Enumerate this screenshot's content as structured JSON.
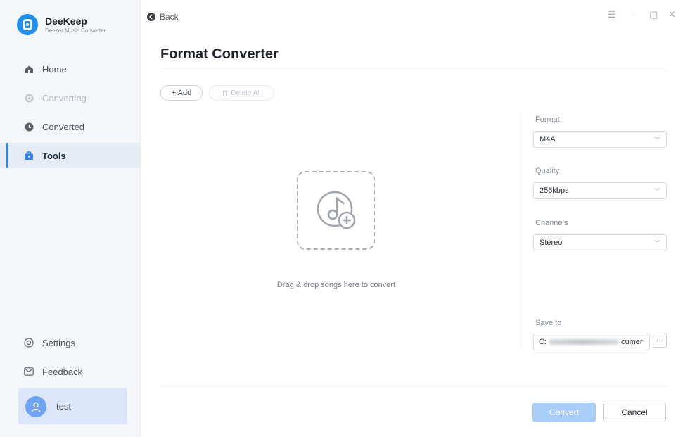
{
  "app": {
    "name": "DeeKeep",
    "subtitle": "Deezer Music Converter"
  },
  "sidebar": {
    "items": [
      {
        "label": "Home",
        "icon": "home-icon",
        "state": "normal"
      },
      {
        "label": "Converting",
        "icon": "converting-icon",
        "state": "disabled"
      },
      {
        "label": "Converted",
        "icon": "clock-icon",
        "state": "normal"
      },
      {
        "label": "Tools",
        "icon": "toolbox-icon",
        "state": "active"
      }
    ],
    "settings_label": "Settings",
    "feedback_label": "Feedback",
    "user_name": "test"
  },
  "topbar": {
    "back_label": "Back",
    "menu_glyph": "☰",
    "minimize_glyph": "–",
    "maximize_glyph": "▢",
    "close_glyph": "✕"
  },
  "main": {
    "title": "Format Converter",
    "add_label": "+ Add",
    "delete_all_label": "Delete All",
    "drop_text": "Drag & drop songs here to convert"
  },
  "settings": {
    "format": {
      "label": "Format",
      "value": "M4A"
    },
    "quality": {
      "label": "Quality",
      "value": "256kbps"
    },
    "channels": {
      "label": "Channels",
      "value": "Stereo"
    },
    "save_to": {
      "label": "Save to",
      "value_start": "C:",
      "value_end": "cumer",
      "browse_label": "···"
    }
  },
  "actions": {
    "convert_label": "Convert",
    "cancel_label": "Cancel"
  },
  "colors": {
    "accent": "#2f7ff5",
    "convert_disabled": "#a9cdf9",
    "sidebar_bg": "#f4f6f9"
  }
}
